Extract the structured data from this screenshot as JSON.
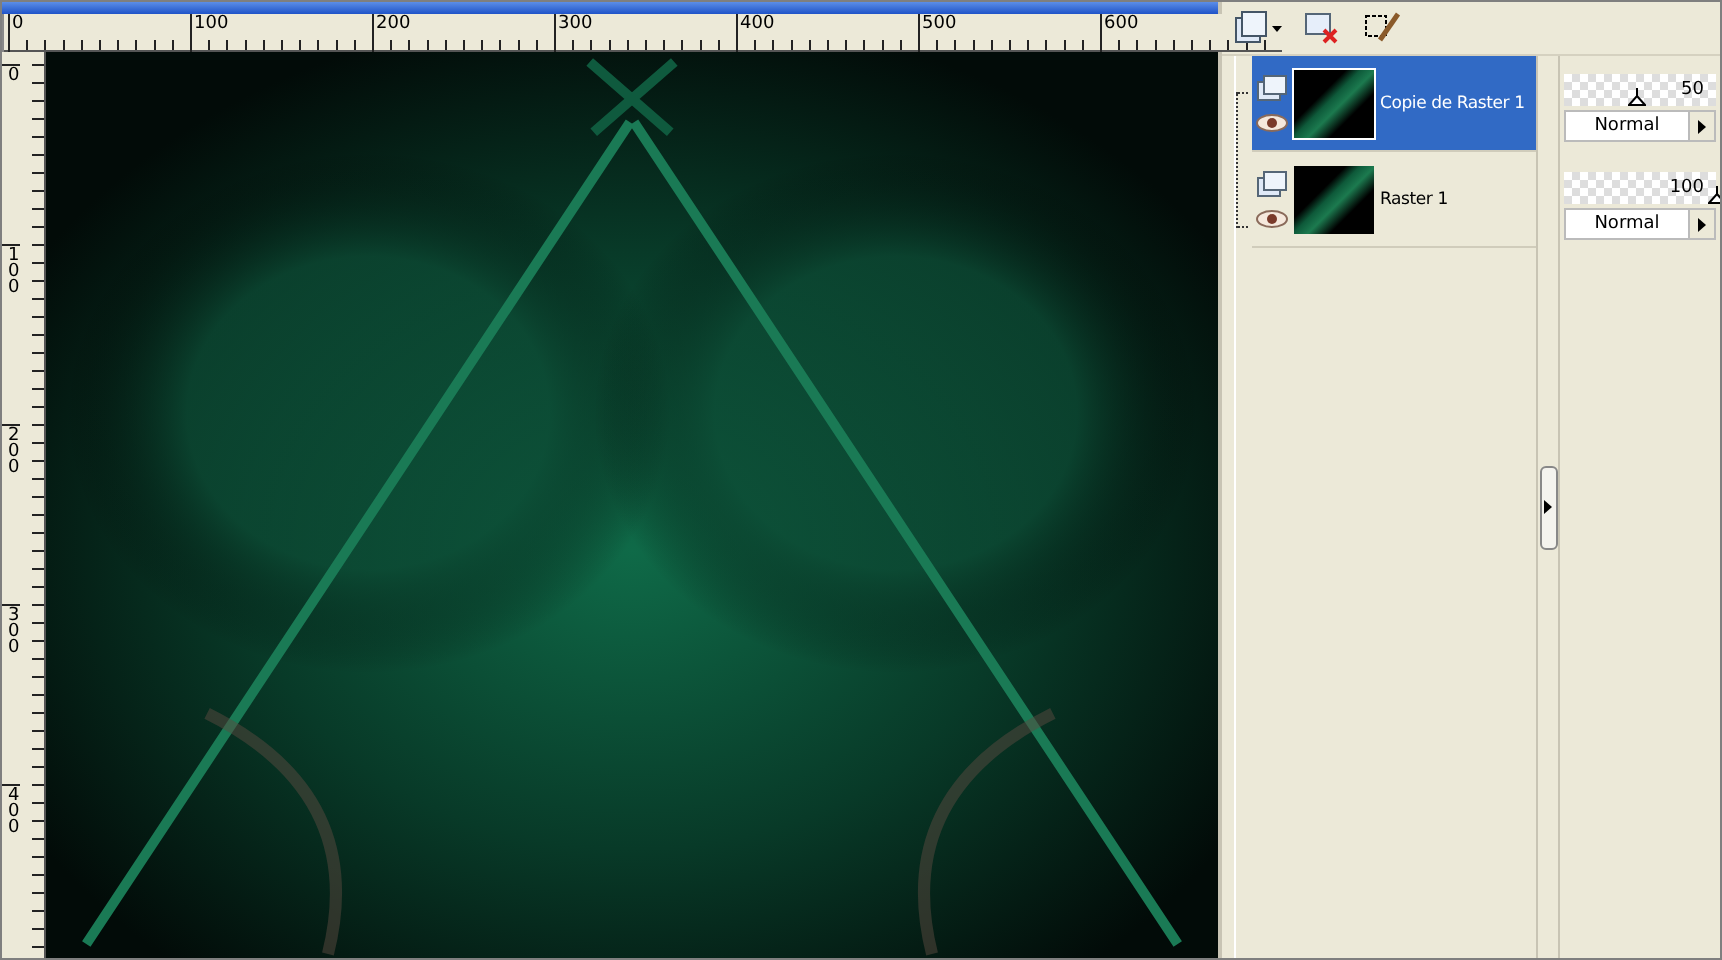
{
  "h_ruler": {
    "labels": [
      "0",
      "100",
      "200",
      "300",
      "400",
      "500",
      "600"
    ]
  },
  "v_ruler": {
    "labels": [
      "0",
      "100",
      "200",
      "300",
      "400"
    ]
  },
  "layers": [
    {
      "name": "Copie de Raster 1",
      "selected": true,
      "opacity": "50",
      "level": 0.47,
      "blend_mode": "Normal"
    },
    {
      "name": "Raster 1",
      "selected": false,
      "opacity": "100",
      "level": 1,
      "blend_mode": "Normal"
    }
  ]
}
